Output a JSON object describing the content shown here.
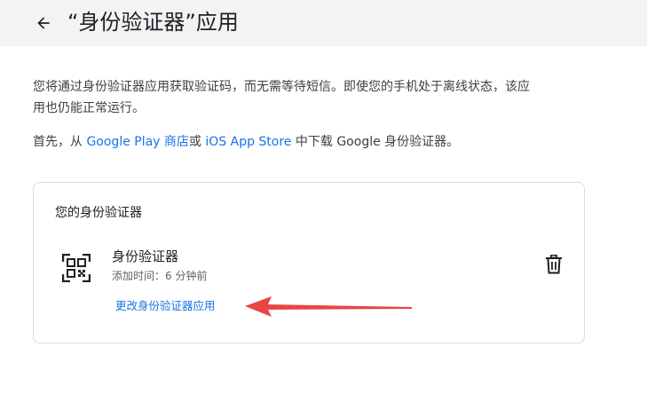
{
  "header": {
    "back_icon": "arrow-left-icon",
    "title": "“身份验证器”应用"
  },
  "intro": {
    "text": "您将通过身份验证器应用获取验证码，而无需等待短信。即使您的手机处于离线状态，该应用也仍能正常运行。"
  },
  "download": {
    "prefix": "首先，从 ",
    "google_play_link": "Google Play 商店",
    "middle": "或 ",
    "app_store_link": "iOS App Store",
    "suffix": " 中下载 Google 身份验证器。"
  },
  "card": {
    "title": "您的身份验证器",
    "app_icon": "qr-code-icon",
    "app_name": "身份验证器",
    "added_time": "添加时间：6 分钟前",
    "change_link": "更改身份验证器应用",
    "delete_icon": "trash-icon"
  },
  "colors": {
    "header_bg": "#f1f3f4",
    "link": "#1a73e8",
    "annotation_arrow": "#e84545"
  }
}
